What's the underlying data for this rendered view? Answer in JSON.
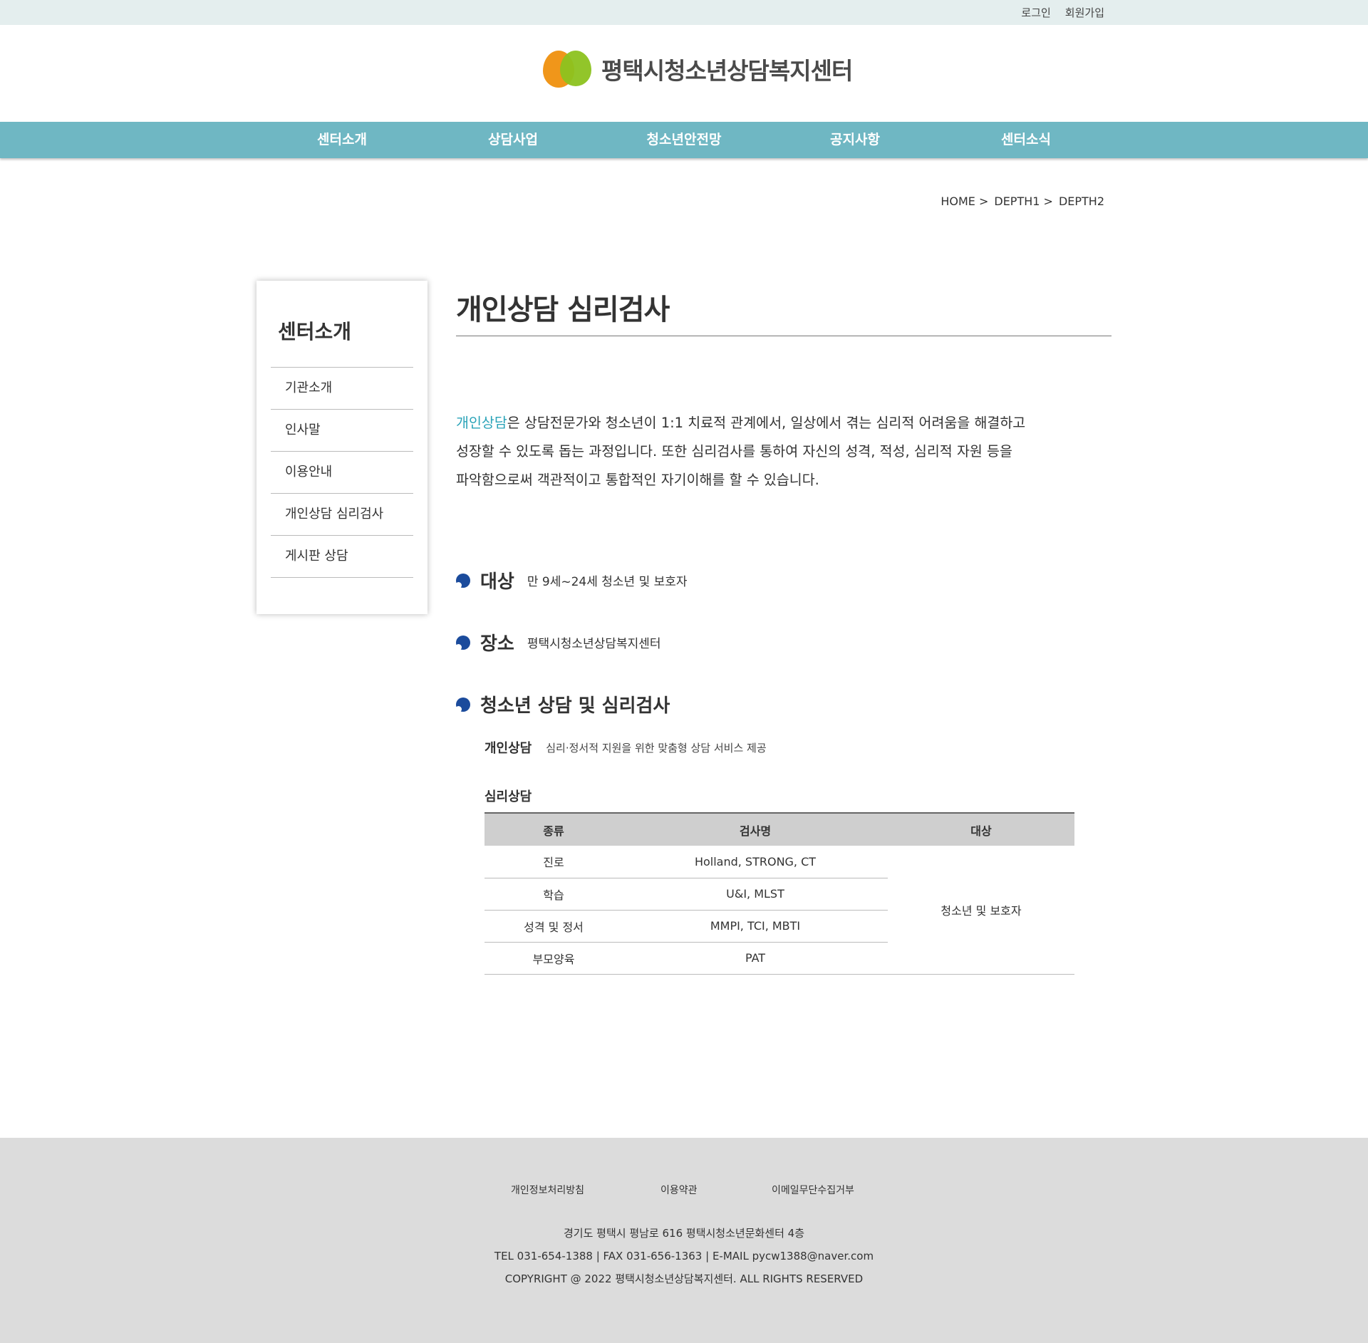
{
  "top": {
    "login": "로그인",
    "signup": "회원가입"
  },
  "logo": {
    "text": "평택시청소년상담복지센터"
  },
  "gnb": [
    "센터소개",
    "상담사업",
    "청소년안전망",
    "공지사항",
    "센터소식"
  ],
  "breadcrumb": [
    "HOME >",
    "DEPTH1 >",
    "DEPTH2"
  ],
  "lnb": {
    "title": "센터소개",
    "items": [
      "기관소개",
      "인사말",
      "이용안내",
      "개인상담 심리검사",
      "게시판 상담"
    ]
  },
  "content": {
    "title": "개인상담 심리검사",
    "intro_highlight": "개인상담",
    "intro_line1_rest": "은 상담전문가와 청소년이 1:1 치료적 관계에서, 일상에서 겪는 심리적 어려움을 해결하고",
    "intro_line2": "성장할 수 있도록 돕는 과정입니다. 또한 심리검사를 통하여 자신의 성격, 적성, 심리적 자원 등을",
    "intro_line3": "파악함으로써 객관적이고 통합적인 자기이해를 할 수 있습니다.",
    "sections": [
      {
        "title": "대상",
        "desc": "만 9세~24세 청소년 및 보호자"
      },
      {
        "title": "장소",
        "desc": "평택시청소년상담복지센터"
      },
      {
        "title": "청소년 상담 및 심리검사",
        "desc": ""
      }
    ],
    "sub": {
      "label": "개인상담",
      "text": "심리·정서적 지원을 위한 맞춤형 상담 서비스 제공"
    },
    "table": {
      "title": "심리상담",
      "headers": [
        "종류",
        "검사명",
        "대상"
      ],
      "rows": [
        [
          "진로",
          "Holland, STRONG, CT"
        ],
        [
          "학습",
          "U&I, MLST"
        ],
        [
          "성격 및 정서",
          "MMPI, TCI, MBTI"
        ],
        [
          "부모양육",
          "PAT"
        ]
      ],
      "target": "청소년 및 보호자"
    }
  },
  "footer": {
    "links": [
      "개인정보처리방침",
      "이용약관",
      "이메일무단수집거부"
    ],
    "address": "경기도 평택시 평남로 616 평택시청소년문화센터 4층",
    "contact": "TEL 031-654-1388 | FAX 031-656-1363 | E-MAIL pycw1388@naver.com",
    "copyright": "COPYRIGHT @ 2022 평택시청소년상담복지센터. ALL RIGHTS RESERVED"
  },
  "colors": {
    "gnb": "#6fb7c3",
    "highlight": "#2aa3b8",
    "bullet": "#1b4b9c",
    "footer": "#dcdcdc"
  }
}
